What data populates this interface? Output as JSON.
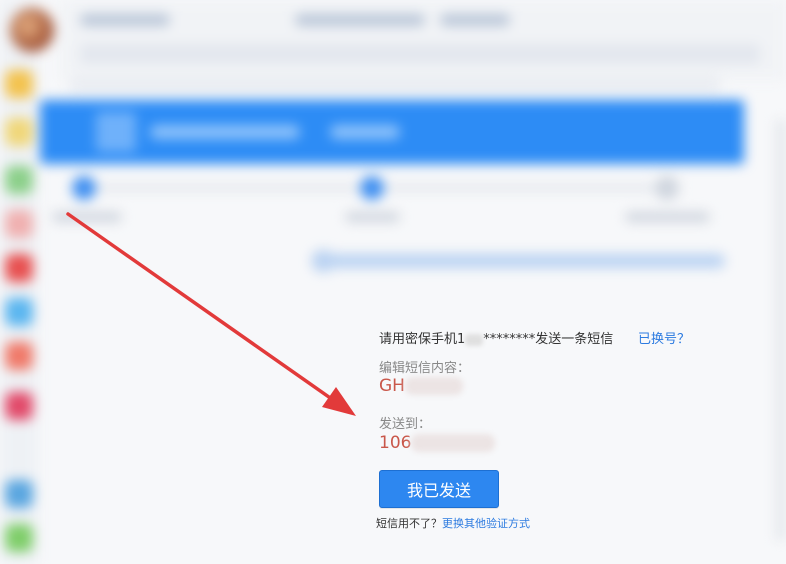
{
  "sms": {
    "instruction_prefix": "请用密保手机1",
    "instruction_masked": "********",
    "instruction_suffix": "发送一条短信",
    "change_number_link": "已换号？",
    "edit_label": "编辑短信内容：",
    "sms_content": "GH",
    "send_to_label": "发送到：",
    "send_to_number": "106",
    "send_button": "我已发送",
    "footer_prefix": "短信用不了？",
    "footer_link": "更换其他验证方式"
  },
  "colors": {
    "accent": "#2d87f0",
    "link": "#2d7be0",
    "value": "#c9574a",
    "arrow": "#e23a3a"
  }
}
